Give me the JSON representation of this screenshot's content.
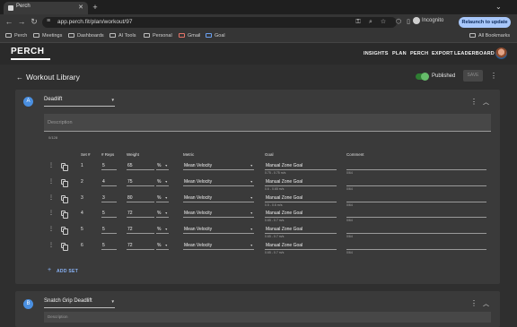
{
  "browser": {
    "tab_title": "Perch",
    "url": "app.perch.fit/plan/workout/97",
    "incognito_label": "Incognito",
    "relaunch_label": "Relaunch to update",
    "bookmarks": [
      "Perch",
      "Meetings",
      "Dashboards",
      "AI Tools",
      "Personal",
      "Gmail",
      "Goal"
    ],
    "all_bookmarks_label": "All Bookmarks"
  },
  "app": {
    "logo": "PERCH",
    "nav": [
      "INSIGHTS",
      "PLAN",
      "PERCH",
      "EXPORT",
      "LEADERBOARD"
    ]
  },
  "page": {
    "title": "Workout Library",
    "published_label": "Published",
    "published": true,
    "save_label": "SAVE"
  },
  "exercises": [
    {
      "badge": "A",
      "name": "Deadlift",
      "description_placeholder": "Description",
      "char_count": "0/128",
      "columns": [
        "Set #",
        "# Reps",
        "Weight",
        "Metric",
        "Goal",
        "Comment"
      ],
      "sets": [
        {
          "set": "1",
          "reps": "5",
          "weight": "65",
          "unit": "%",
          "metric": "Mean Velocity",
          "goal": "Manual Zone Goal",
          "range": "0.75 - 0.75 m/s",
          "comment_count": "0/64"
        },
        {
          "set": "2",
          "reps": "4",
          "weight": "75",
          "unit": "%",
          "metric": "Mean Velocity",
          "goal": "Manual Zone Goal",
          "range": "0.6 - 0.65 m/s",
          "comment_count": "0/64"
        },
        {
          "set": "3",
          "reps": "3",
          "weight": "80",
          "unit": "%",
          "metric": "Mean Velocity",
          "goal": "Manual Zone Goal",
          "range": "0.5 - 0.6 m/s",
          "comment_count": "0/64"
        },
        {
          "set": "4",
          "reps": "5",
          "weight": "72",
          "unit": "%",
          "metric": "Mean Velocity",
          "goal": "Manual Zone Goal",
          "range": "0.65 - 0.7 m/s",
          "comment_count": "0/64"
        },
        {
          "set": "5",
          "reps": "5",
          "weight": "72",
          "unit": "%",
          "metric": "Mean Velocity",
          "goal": "Manual Zone Goal",
          "range": "0.65 - 0.7 m/s",
          "comment_count": "0/64"
        },
        {
          "set": "6",
          "reps": "5",
          "weight": "72",
          "unit": "%",
          "metric": "Mean Velocity",
          "goal": "Manual Zone Goal",
          "range": "0.65 - 0.7 m/s",
          "comment_count": "0/64"
        }
      ],
      "add_set_label": "ADD SET"
    },
    {
      "badge": "B",
      "name": "Snatch Grip Deadlift",
      "description_placeholder": "Description"
    }
  ],
  "colors": {
    "accent": "#4a8fe0",
    "link": "#8ab4f8",
    "toggle_on": "#66bb6a"
  }
}
